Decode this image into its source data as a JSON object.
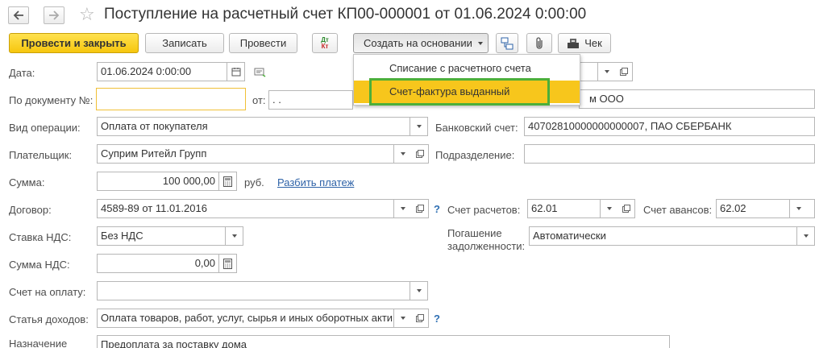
{
  "window": {
    "title": "Поступление на расчетный счет КП00-000001 от 01.06.2024 0:00:00"
  },
  "toolbar": {
    "post_close": "Провести и закрыть",
    "save": "Записать",
    "post": "Провести",
    "dt_kt_top": "Дт",
    "dt_kt_bottom": "Кт",
    "create_basis": "Создать на основании",
    "receipt": "Чек"
  },
  "menu": {
    "items": [
      {
        "label": "Списание с расчетного счета"
      },
      {
        "label": "Счет-фактура выданный"
      }
    ]
  },
  "form": {
    "date_label": "Дата:",
    "date_value": "01.06.2024  0:00:00",
    "doc_num_label": "По документу №:",
    "doc_num_value": "",
    "from_label": "от:",
    "from_value": " .  .",
    "org_value_partial": "м ООО",
    "op_type_label": "Вид операции:",
    "op_type_value": "Оплата от покупателя",
    "bank_label": "Банковский счет:",
    "bank_value": "40702810000000000007, ПАО СБЕРБАНК",
    "payer_label": "Плательщик:",
    "payer_value": "Суприм Ритейл Групп",
    "division_label": "Подразделение:",
    "division_value": "",
    "sum_label": "Сумма:",
    "sum_value": "100 000,00",
    "currency": "руб.",
    "split_link": "Разбить платеж",
    "contract_label": "Договор:",
    "contract_value": "4589-89 от 11.01.2016",
    "help_mark": "?",
    "acc_settle_label": "Счет расчетов:",
    "acc_settle_value": "62.01",
    "acc_adv_label": "Счет авансов:",
    "acc_adv_value": "62.02",
    "vat_rate_label": "Ставка НДС:",
    "vat_rate_value": "Без НДС",
    "debt_label_1": "Погашение",
    "debt_label_2": "задолженности:",
    "debt_value": "Автоматически",
    "vat_sum_label": "Сумма НДС:",
    "vat_sum_value": "0,00",
    "invoice_label": "Счет на оплату:",
    "invoice_value": "",
    "income_label": "Статья доходов:",
    "income_value": "Оплата товаров, работ, услуг, сырья и иных оборотных акти",
    "purpose_label": "Назначение",
    "purpose_value": "Предоплата за поставку дома"
  },
  "colors": {
    "primary_button": "#f6c60e",
    "menu_highlight": "#f7c61c",
    "highlight_frame": "#4caf3a",
    "link": "#2f63a8"
  }
}
